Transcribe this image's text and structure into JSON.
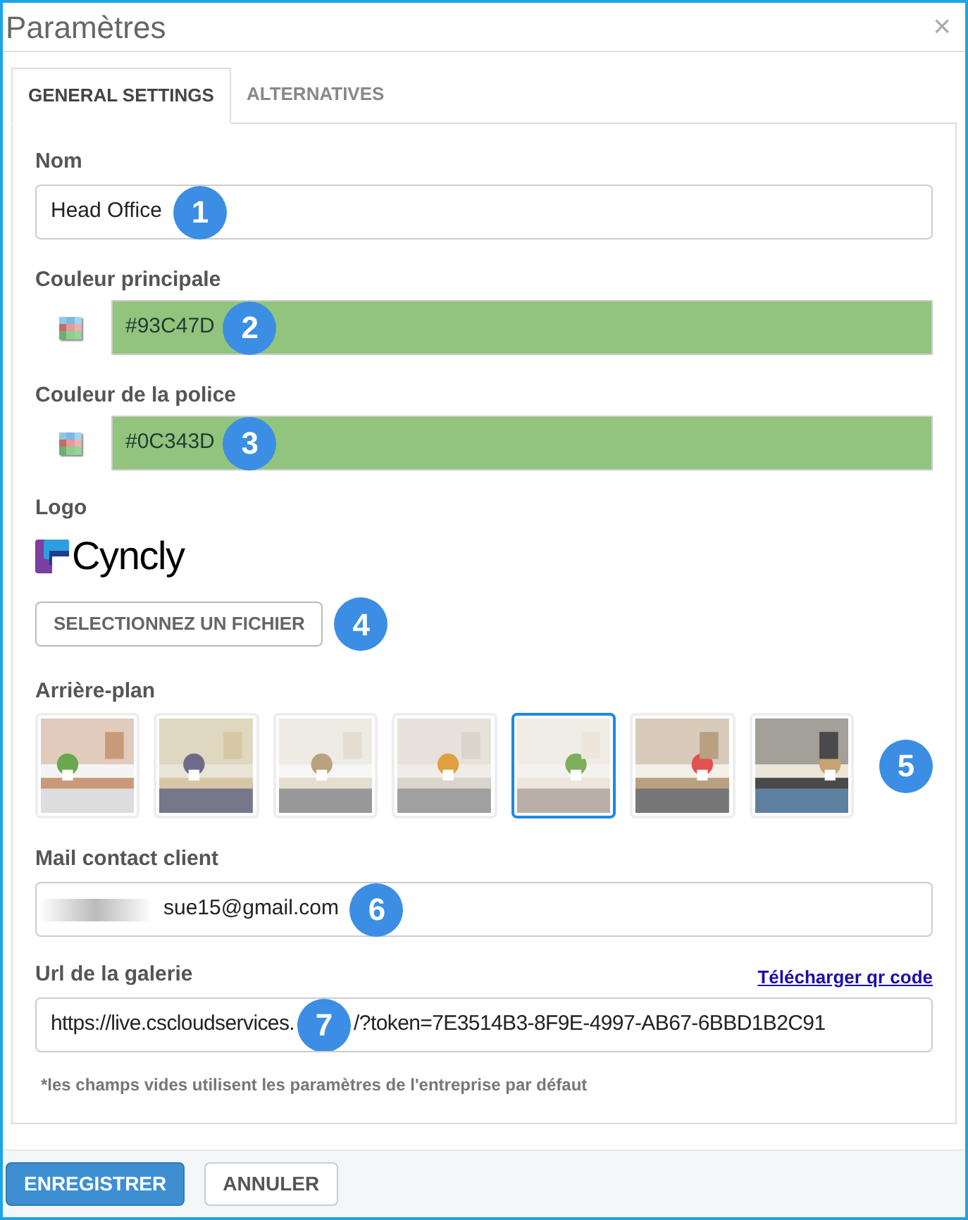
{
  "window": {
    "title": "Paramètres",
    "close": "×"
  },
  "tabs": [
    {
      "label": "GENERAL SETTINGS",
      "selected": true
    },
    {
      "label": "ALTERNATIVES",
      "selected": false
    }
  ],
  "name_field": {
    "label": "Nom",
    "value": "Head Office",
    "marker": "1"
  },
  "main_color": {
    "label": "Couleur principale",
    "value": "#93C47D",
    "marker": "2"
  },
  "font_color": {
    "label": "Couleur de la police",
    "value": "#0C343D",
    "marker": "3"
  },
  "logo": {
    "label": "Logo",
    "text": "Cyncly",
    "button": "SELECTIONNEZ UN FICHIER",
    "marker": "4"
  },
  "background": {
    "label": "Arrière-plan",
    "marker": "5",
    "thumbnails": [
      {
        "kind": "picture",
        "selected": false
      },
      {
        "kind": "picture",
        "selected": false
      },
      {
        "kind": "picture",
        "selected": false
      },
      {
        "kind": "picture",
        "selected": false
      },
      {
        "kind": "picture",
        "selected": true
      },
      {
        "kind": "picture",
        "selected": false
      },
      {
        "kind": "picture",
        "selected": false
      }
    ]
  },
  "mail": {
    "label": "Mail contact client",
    "value": "sue15@gmail.com",
    "redacted": true,
    "marker": "6"
  },
  "gallery_url": {
    "label": "Url de la galerie",
    "link": "Télécharger qr code",
    "value_start": "https://live.cscloudservices.",
    "value_end": "/?token=7E3514B3-8F9E-4997-AB67-6BBD1B2C91",
    "marker": "7"
  },
  "note": "*les champs vides utilisent les paramètres de l'entreprise par défaut",
  "buttons": [
    {
      "label": "ENREGISTRER",
      "kind": "primary"
    },
    {
      "label": "ANNULER",
      "kind": "secondary"
    }
  ]
}
